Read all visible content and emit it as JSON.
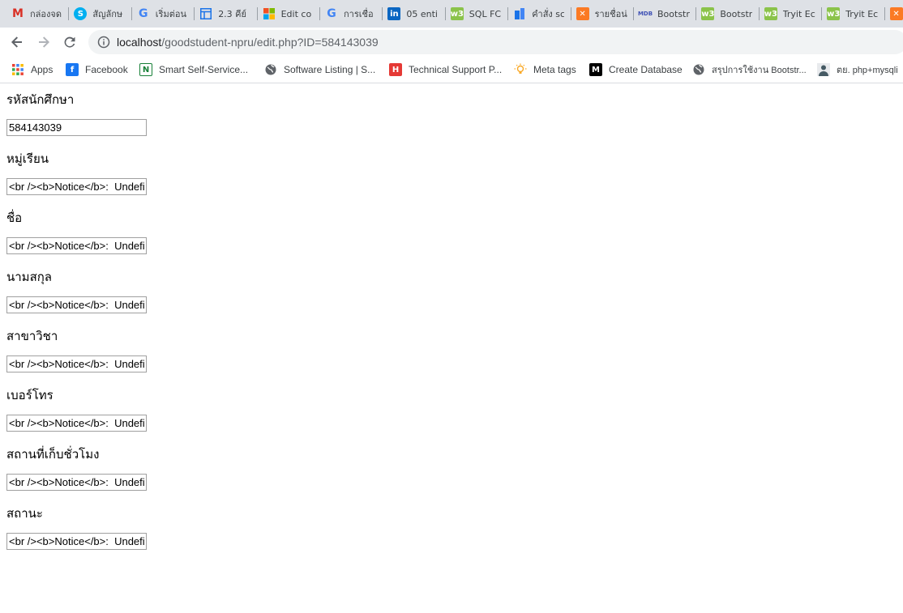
{
  "browser": {
    "tabs": [
      {
        "label": "กล่องจด",
        "icon": "gmail-icon",
        "color": "#d93025",
        "glyph": "M"
      },
      {
        "label": "สัญลักษ",
        "icon": "skype-icon",
        "color": "#00aff0",
        "glyph": "S"
      },
      {
        "label": "เริ่มต่อน",
        "icon": "google-icon",
        "color": "#4285f4",
        "glyph": "G"
      },
      {
        "label": "2.3 คีย์",
        "icon": "layout-icon",
        "color": "#1a73e8",
        "glyph": ""
      },
      {
        "label": "Edit co",
        "icon": "microsoft-icon",
        "color": "#f25022",
        "glyph": ""
      },
      {
        "label": "การเชื่อ",
        "icon": "google-icon",
        "color": "#4285f4",
        "glyph": "G"
      },
      {
        "label": "05 enti",
        "icon": "linkedin-icon",
        "color": "#0a66c2",
        "glyph": "in"
      },
      {
        "label": "SQL FC",
        "icon": "w3schools-icon",
        "color": "#8bc34a",
        "glyph": "w3"
      },
      {
        "label": "คำสั่ง sc",
        "icon": "building-icon",
        "color": "#1a73e8",
        "glyph": ""
      },
      {
        "label": "รายชื่อน่",
        "icon": "xampp-icon",
        "color": "#fb7a24",
        "glyph": "✕"
      },
      {
        "label": "Bootstr",
        "icon": "mdb-icon",
        "color": "#3f51b5",
        "glyph": "MDB"
      },
      {
        "label": "Bootstr",
        "icon": "w3schools-icon",
        "color": "#8bc34a",
        "glyph": "w3"
      },
      {
        "label": "Tryit Ec",
        "icon": "w3schools-icon",
        "color": "#8bc34a",
        "glyph": "w3"
      },
      {
        "label": "Tryit Ec",
        "icon": "w3schools-icon",
        "color": "#8bc34a",
        "glyph": "w3"
      },
      {
        "label": "",
        "icon": "xampp-icon",
        "color": "#fb7a24",
        "glyph": "✕"
      }
    ],
    "url_host": "localhost",
    "url_path": "/goodstudent-npru/edit.php?ID=584143039",
    "bookmarks": [
      {
        "label": "Apps",
        "icon": "apps-grid-icon"
      },
      {
        "label": "Facebook",
        "icon": "facebook-icon",
        "color": "#1877f2",
        "glyph": "f"
      },
      {
        "label": "Smart Self-Service...",
        "icon": "n-logo-icon",
        "color": "#188038",
        "glyph": "N"
      },
      {
        "label": "Software Listing | S...",
        "icon": "globe-icon"
      },
      {
        "label": "Technical Support P...",
        "icon": "h-logo-icon",
        "color": "#e53935",
        "glyph": "H"
      },
      {
        "label": "Meta tags",
        "icon": "lightbulb-icon"
      },
      {
        "label": "Create Database",
        "icon": "medium-icon",
        "color": "#000000",
        "glyph": "M"
      },
      {
        "label": "สรุปการใช้งาน Bootstr...",
        "icon": "globe-icon"
      },
      {
        "label": "ตย. php+mysqli",
        "icon": "user-avatar-icon"
      }
    ]
  },
  "form": {
    "fields": [
      {
        "label": "รหัสนักศึกษา",
        "value": "584143039"
      },
      {
        "label": "หมู่เรียน",
        "value": "<br /><b>Notice</b>:  Undefined"
      },
      {
        "label": "ชื่อ",
        "value": "<br /><b>Notice</b>:  Undefined"
      },
      {
        "label": "นามสกุล",
        "value": "<br /><b>Notice</b>:  Undefined"
      },
      {
        "label": "สาขาวิชา",
        "value": "<br /><b>Notice</b>:  Undefined"
      },
      {
        "label": "เบอร์โทร",
        "value": "<br /><b>Notice</b>:  Undefined"
      },
      {
        "label": "สถานที่เก็บชั่วโมง",
        "value": "<br /><b>Notice</b>:  Undefined"
      },
      {
        "label": "สถานะ",
        "value": "<br /><b>Notice</b>:  Undefined"
      }
    ]
  }
}
